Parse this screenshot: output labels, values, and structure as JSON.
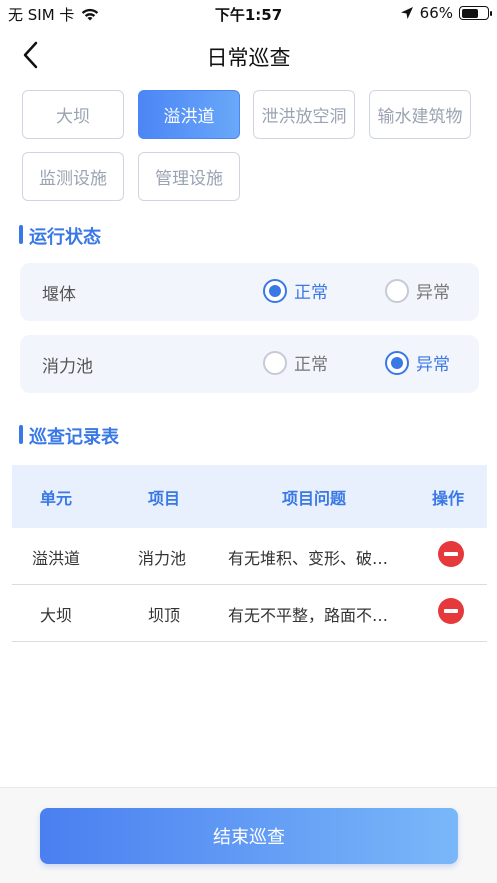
{
  "status_bar": {
    "carrier": "无 SIM 卡",
    "time": "下午1:57",
    "battery": "66%",
    "battery_level": 0.66
  },
  "nav": {
    "title": "日常巡查"
  },
  "tabs": [
    {
      "label": "大坝",
      "active": false
    },
    {
      "label": "溢洪道",
      "active": true
    },
    {
      "label": "泄洪放空洞",
      "active": false
    },
    {
      "label": "输水建筑物",
      "active": false
    },
    {
      "label": "监测设施",
      "active": false
    },
    {
      "label": "管理设施",
      "active": false
    }
  ],
  "status_section": {
    "title": "运行状态",
    "rows": [
      {
        "label": "堰体",
        "options": [
          "正常",
          "异常"
        ],
        "selected": "正常"
      },
      {
        "label": "消力池",
        "options": [
          "正常",
          "异常"
        ],
        "selected": "异常"
      }
    ]
  },
  "records_section": {
    "title": "巡查记录表",
    "columns": [
      "单元",
      "项目",
      "项目问题",
      "操作"
    ],
    "rows": [
      {
        "unit": "溢洪道",
        "item": "消力池",
        "issue": "有无堆积、变形、破…"
      },
      {
        "unit": "大坝",
        "item": "坝顶",
        "issue": "有无不平整，路面不…"
      }
    ]
  },
  "footer": {
    "end_button": "结束巡查"
  },
  "colors": {
    "accent": "#3a78e6",
    "delete": "#e5393b"
  }
}
